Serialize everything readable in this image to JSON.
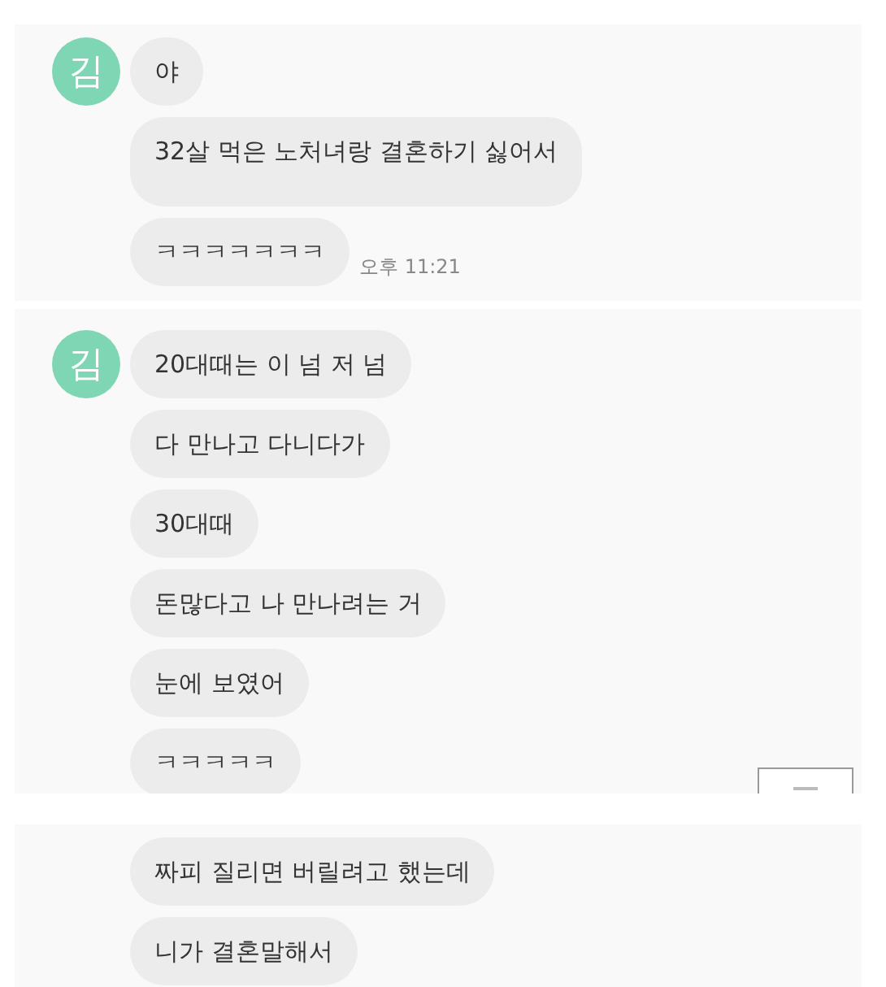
{
  "panels": [
    {
      "avatar": "김",
      "messages": [
        {
          "text": "야"
        },
        {
          "text": "32살 먹은 노처녀랑 결혼하기 싫어서"
        },
        {
          "text": "ㅋㅋㅋㅋㅋㅋㅋ"
        }
      ],
      "time": "오후 11:21"
    },
    {
      "avatar": "김",
      "messages": [
        {
          "text": "20대때는 이 넘 저 넘"
        },
        {
          "text": "다 만나고 다니다가"
        },
        {
          "text": "30대때"
        },
        {
          "text": "돈많다고 나 만나려는 거"
        },
        {
          "text": "눈에 보였어"
        },
        {
          "text": "ㅋㅋㅋㅋㅋ"
        }
      ],
      "scroll_button": true
    },
    {
      "messages": [
        {
          "text": "짜피 질리면 버릴려고 했는데"
        },
        {
          "text": "니가 결혼말해서"
        }
      ]
    }
  ]
}
